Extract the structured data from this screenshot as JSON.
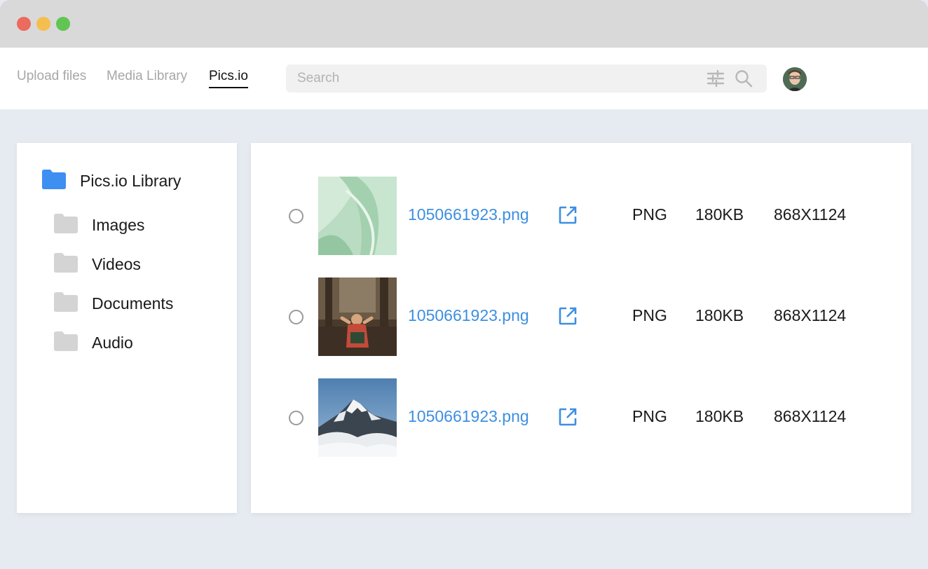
{
  "header": {
    "tabs": [
      {
        "label": "Upload files",
        "active": false
      },
      {
        "label": "Media Library",
        "active": false
      },
      {
        "label": "Pics.io",
        "active": true
      }
    ],
    "search": {
      "placeholder": "Search",
      "value": ""
    },
    "icons": [
      "filter-sliders-icon",
      "search-icon"
    ]
  },
  "sidebar": {
    "root": {
      "label": "Pics.io Library",
      "icon": "folder-icon",
      "color": "#3d8ff2"
    },
    "folders": [
      {
        "label": "Images",
        "icon": "folder-icon"
      },
      {
        "label": "Videos",
        "icon": "folder-icon"
      },
      {
        "label": "Documents",
        "icon": "folder-icon"
      },
      {
        "label": "Audio",
        "icon": "folder-icon"
      }
    ]
  },
  "files": [
    {
      "name": "1050661923.png",
      "type": "PNG",
      "size": "180KB",
      "dimensions": "868X1124",
      "thumbnail": "green-abstract-waves"
    },
    {
      "name": "1050661923.png",
      "type": "PNG",
      "size": "180KB",
      "dimensions": "868X1124",
      "thumbnail": "person-in-forest"
    },
    {
      "name": "1050661923.png",
      "type": "PNG",
      "size": "180KB",
      "dimensions": "868X1124",
      "thumbnail": "snowy-mountain-peak"
    }
  ],
  "colors": {
    "accent": "#3d8fe0",
    "folder_gray": "#d4d4d4",
    "background": "#e6ebf1"
  }
}
